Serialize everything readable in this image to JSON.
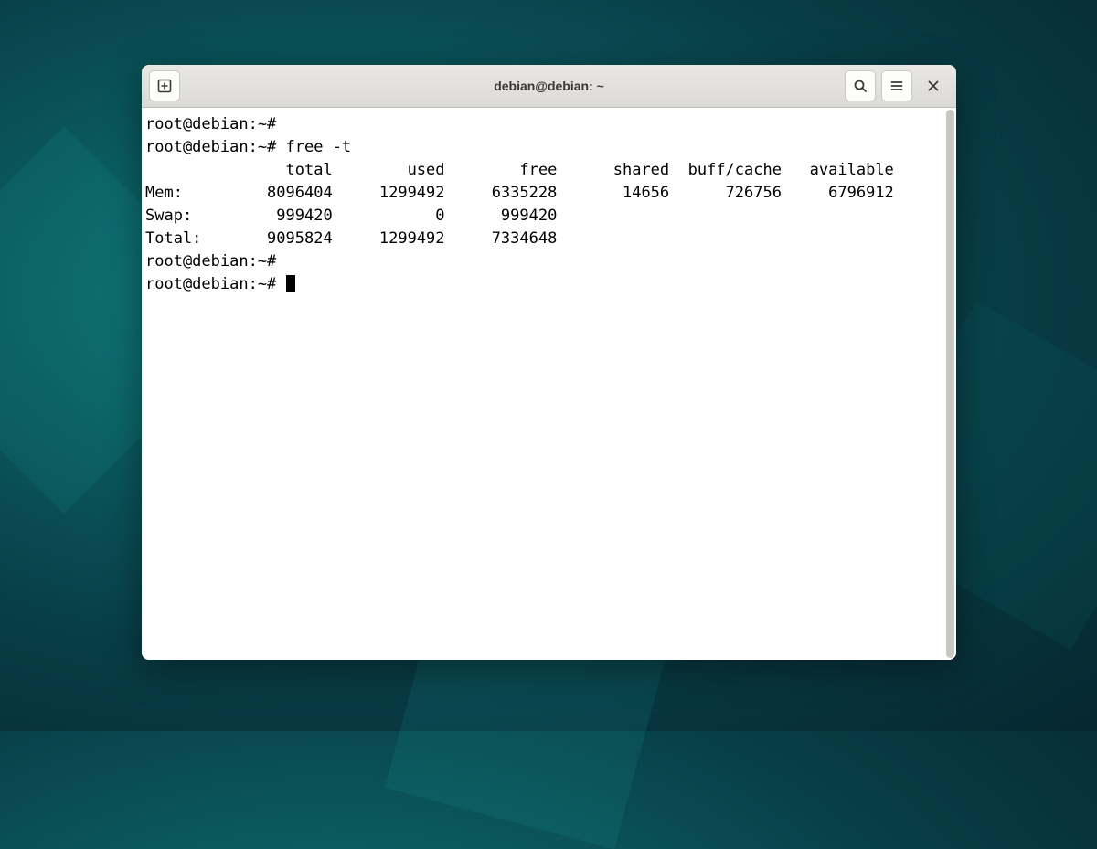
{
  "window": {
    "title": "debian@debian: ~"
  },
  "terminal": {
    "prompt": "root@debian:~#",
    "lines": [
      "root@debian:~#",
      "root@debian:~# free -t",
      "               total        used        free      shared  buff/cache   available",
      "Mem:         8096404     1299492     6335228       14656      726756     6796912",
      "Swap:         999420           0      999420",
      "Total:       9095824     1299492     7334648",
      "root@debian:~#"
    ],
    "command": "free -t",
    "table": {
      "headers": [
        "",
        "total",
        "used",
        "free",
        "shared",
        "buff/cache",
        "available"
      ],
      "rows": [
        {
          "label": "Mem:",
          "total": 8096404,
          "used": 1299492,
          "free": 6335228,
          "shared": 14656,
          "buff_cache": 726756,
          "available": 6796912
        },
        {
          "label": "Swap:",
          "total": 999420,
          "used": 0,
          "free": 999420
        },
        {
          "label": "Total:",
          "total": 9095824,
          "used": 1299492,
          "free": 7334648
        }
      ]
    }
  }
}
